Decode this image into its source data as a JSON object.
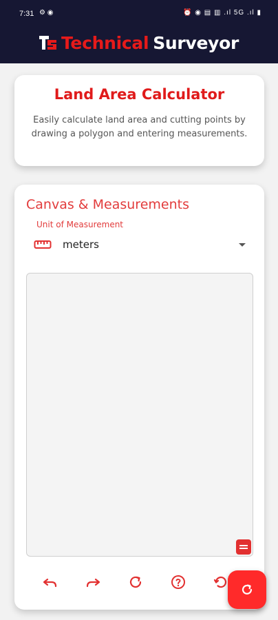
{
  "status_bar": {
    "time": "7:31",
    "left_icons": "⚙ ◉",
    "right_icons": "⏰ ◉ ▤ ▥ .ıl 5G .ıl ▮"
  },
  "header": {
    "logo_text": "TS",
    "brand_part1": "Technical",
    "brand_part2": "Surveyor"
  },
  "intro_card": {
    "title": "Land Area Calculator",
    "description": "Easily calculate land area and cutting points by drawing a polygon and entering measurements."
  },
  "measure_card": {
    "section_title": "Canvas & Measurements",
    "unit_label": "Unit of Measurement",
    "unit_value": "meters"
  },
  "colors": {
    "accent": "#e23030",
    "header_bg": "#161733",
    "fab": "#ff2a2a"
  },
  "icons": {
    "ruler": "ruler-icon",
    "undo": "undo-icon",
    "redo": "redo-icon",
    "reset": "refresh-icon",
    "help": "help-icon",
    "fab": "refresh-icon"
  }
}
